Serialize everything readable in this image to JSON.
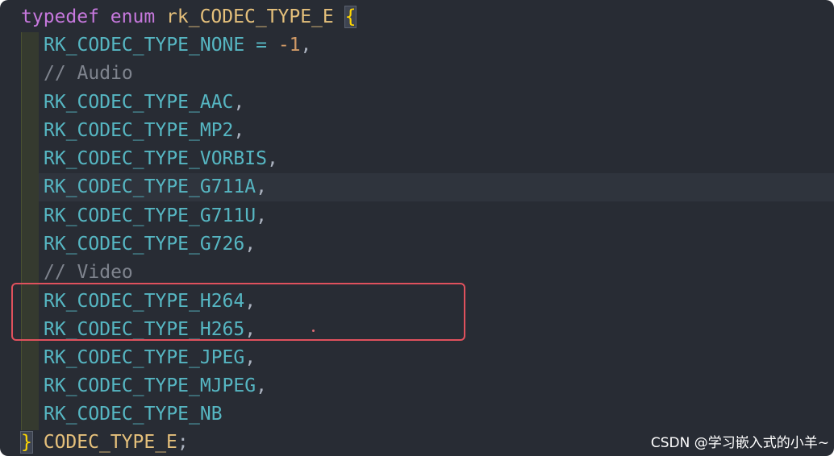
{
  "code": {
    "keyword_typedef": "typedef",
    "keyword_enum": "enum",
    "enum_name": "rk_CODEC_TYPE_E",
    "open_brace": "{",
    "close_brace": "}",
    "typedef_name": "CODEC_TYPE_E",
    "semicolon": ";",
    "none_name": "RK_CODEC_TYPE_NONE",
    "equals": "=",
    "none_value": "-1",
    "comment_audio": "// Audio",
    "comment_video": "// Video",
    "members": [
      "RK_CODEC_TYPE_AAC",
      "RK_CODEC_TYPE_MP2",
      "RK_CODEC_TYPE_VORBIS",
      "RK_CODEC_TYPE_G711A",
      "RK_CODEC_TYPE_G711U",
      "RK_CODEC_TYPE_G726",
      "RK_CODEC_TYPE_H264",
      "RK_CODEC_TYPE_H265",
      "RK_CODEC_TYPE_JPEG",
      "RK_CODEC_TYPE_MJPEG",
      "RK_CODEC_TYPE_NB"
    ],
    "comma": ","
  },
  "watermark": "CSDN @学习嵌入式的小羊~",
  "colors": {
    "background": "#282c34",
    "keyword": "#c678dd",
    "type": "#e5c07b",
    "enum_member": "#56b6c2",
    "number": "#d19a66",
    "comment": "#7f848e",
    "highlight_box": "#e0515d"
  }
}
